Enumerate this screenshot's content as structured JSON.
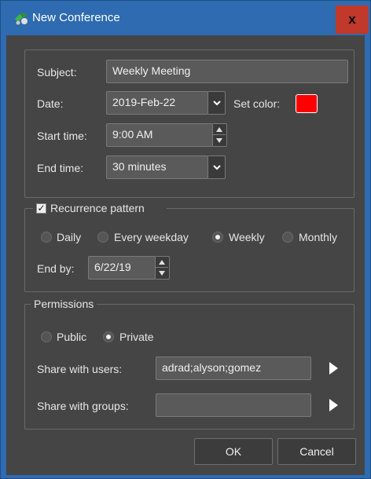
{
  "window": {
    "title": "New Conference",
    "close_label": "x"
  },
  "general": {
    "subject_label": "Subject:",
    "subject_value": "Weekly Meeting",
    "date_label": "Date:",
    "date_value": "2019-Feb-22",
    "set_color_label": "Set color:",
    "set_color_value": "#ff0000",
    "start_time_label": "Start time:",
    "start_time_value": "9:00 AM",
    "end_time_label": "End time:",
    "end_time_value": "30 minutes"
  },
  "recurrence": {
    "checkbox_checked": true,
    "label": "Recurrence pattern",
    "options": [
      {
        "label": "Daily",
        "selected": false
      },
      {
        "label": "Every weekday",
        "selected": false
      },
      {
        "label": "Weekly",
        "selected": true
      },
      {
        "label": "Monthly",
        "selected": false
      }
    ],
    "end_by_label": "End by:",
    "end_by_value": "6/22/19"
  },
  "permissions": {
    "label": "Permissions",
    "options": [
      {
        "label": "Public",
        "selected": false
      },
      {
        "label": "Private",
        "selected": true
      }
    ],
    "share_users_label": "Share with users:",
    "share_users_value": "adrad;alyson;gomez",
    "share_groups_label": "Share with groups:",
    "share_groups_value": ""
  },
  "buttons": {
    "ok": "OK",
    "cancel": "Cancel"
  },
  "colors": {
    "titlebar": "#2e6bb0",
    "client": "#454545",
    "close": "#c0392b"
  },
  "icons": {
    "app": "conference-app-icon",
    "dropdown": "chevron-down-icon",
    "spin_up": "triangle-up-icon",
    "spin_down": "triangle-down-icon",
    "share": "triangle-right-icon"
  }
}
